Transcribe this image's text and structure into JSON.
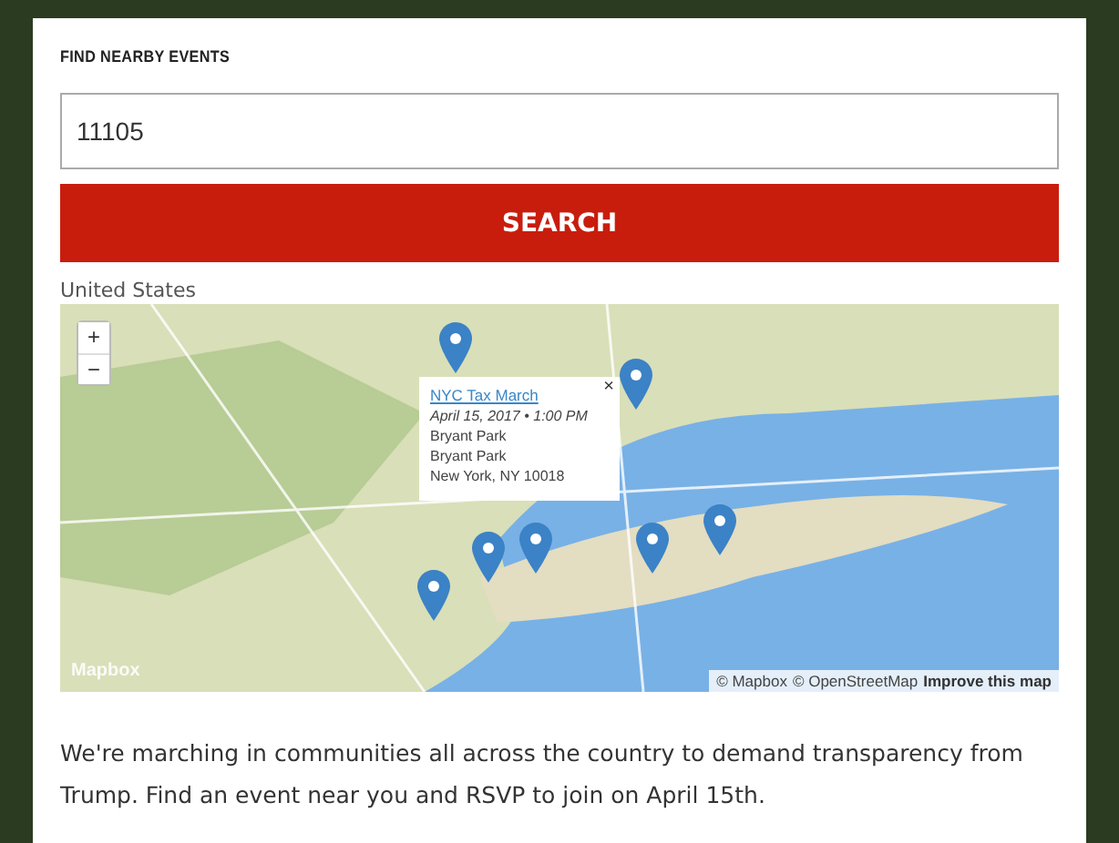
{
  "search_form": {
    "label": "FIND NEARBY EVENTS",
    "zip_value": "11105",
    "button": "SEARCH"
  },
  "map": {
    "country": "United States",
    "zoom_in": "+",
    "zoom_out": "−",
    "logo": "Mapbox",
    "popup": {
      "title": "NYC Tax March",
      "datetime": "April 15, 2017 • 1:00 PM",
      "lines": [
        "Bryant Park",
        "Bryant Park",
        "New York, NY 10018"
      ],
      "close": "×"
    },
    "attribution": [
      "© Mapbox",
      "© OpenStreetMap"
    ],
    "improve_link": "Improve this map"
  },
  "intro": "We're marching in communities all across the country to demand transparency from Trump. Find an event near you and RSVP to join on April 15th."
}
